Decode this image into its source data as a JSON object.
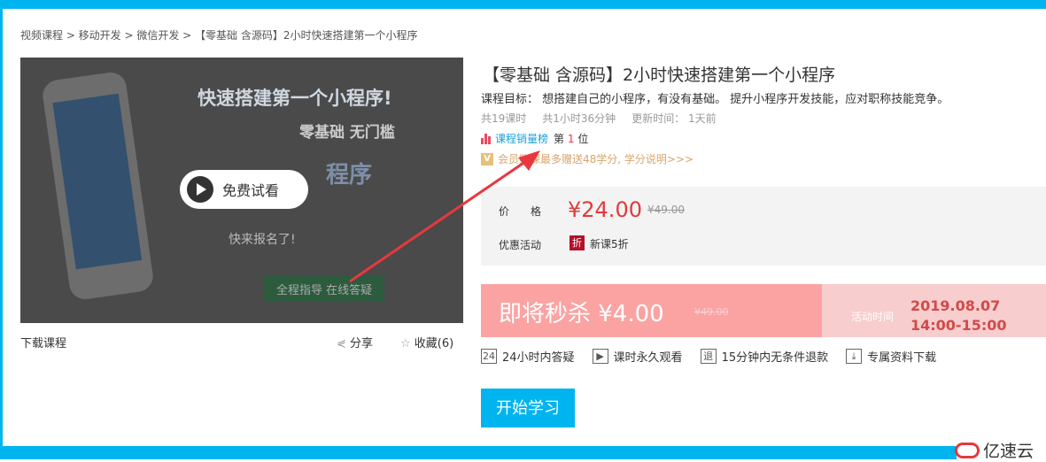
{
  "breadcrumb": "视频课程 > 移动开发 > 微信开发 > 【零基础 含源码】2小时快速搭建第一个小程序",
  "media": {
    "headline": "快速搭建第一个小程序!",
    "sub": "零基础 无门槛",
    "word": "程序",
    "slogan": "快来报名了!",
    "banner": "全程指导 在线答疑",
    "play_label": "免费试看"
  },
  "download_label": "下载课程",
  "share_label": "分享",
  "favorite_label": "收藏(6)",
  "course": {
    "title": "【零基础 含源码】2小时快速搭建第一个小程序",
    "goal": "课程目标： 想搭建自己的小程序，有没有基础。 提升小程序开发技能，应对职称技能竞争。",
    "lessons": "共19课时",
    "duration": "共1小时36分钟",
    "updated": "更新时间： 1天前",
    "rank_link": "课程销量榜",
    "rank_prefix": "第",
    "rank_value": "1",
    "rank_suffix": "位",
    "vip_text": "会员购课最多赠送48学分, 学分说明>>>"
  },
  "price": {
    "label": "价　　格",
    "current": "¥24.00",
    "original": "¥49.00",
    "promo_label": "优惠活动",
    "promo_badge": "折",
    "promo_text": "新课5折"
  },
  "flash_sale": {
    "title": "即将秒杀 ¥4.00",
    "original": "¥49.00",
    "time_label": "活动时间",
    "date": "2019.08.07",
    "time": "14:00-15:00"
  },
  "features": [
    {
      "badge": "24",
      "text": "24小时内答疑"
    },
    {
      "badge": "▶",
      "text": "课时永久观看"
    },
    {
      "badge": "退",
      "text": "15分钟内无条件退款"
    },
    {
      "badge": "⤓",
      "text": "专属资料下载"
    }
  ],
  "start_button": "开始学习",
  "watermark": "亿速云",
  "colors": {
    "accent": "#00b4ef",
    "price": "#e4393c",
    "sale_bg": "#fba3a3"
  }
}
